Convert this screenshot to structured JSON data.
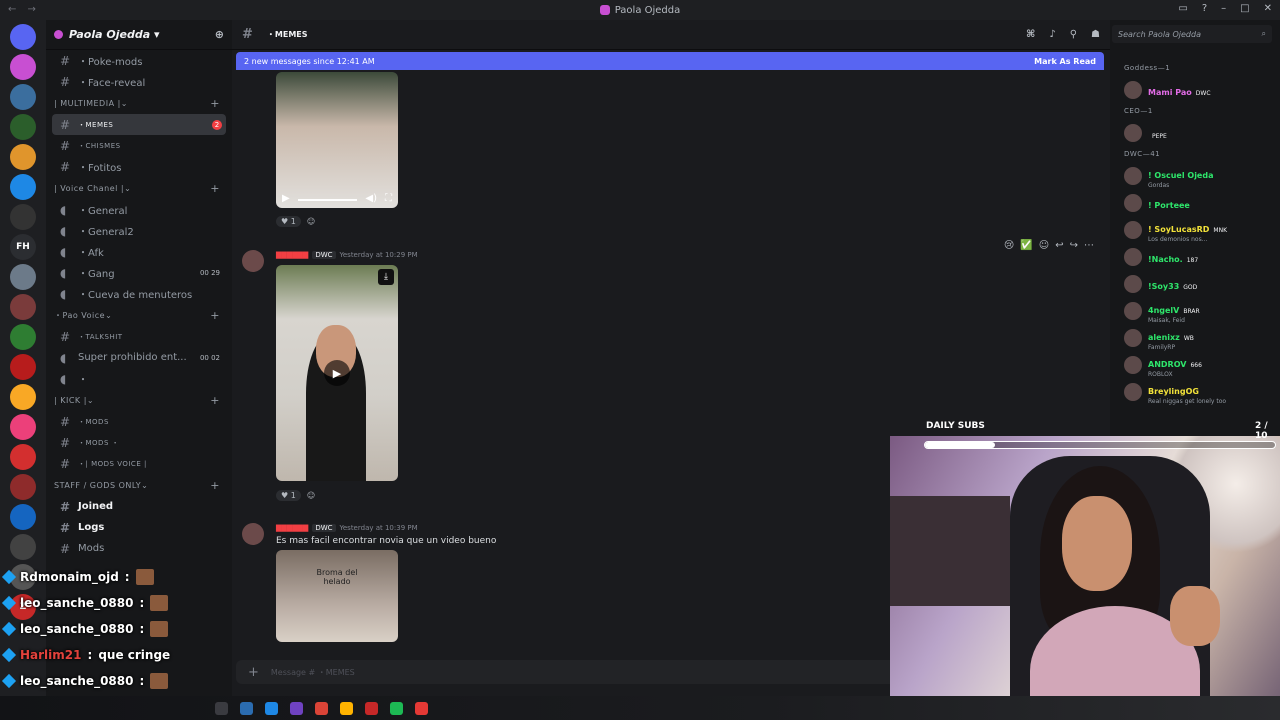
{
  "titlebar": {
    "title": "Paola Ojedda",
    "nav": "← →"
  },
  "servers": [
    {
      "label": "",
      "color": "#5865f2"
    },
    {
      "label": "",
      "color": "#c84fd2"
    },
    {
      "label": "",
      "color": "#3b6e9e"
    },
    {
      "label": "",
      "color": "#2b5e2b"
    },
    {
      "label": "",
      "color": "#e0952c"
    },
    {
      "label": "",
      "color": "#1e88e5"
    },
    {
      "label": "",
      "color": "#333"
    },
    {
      "label": "FH",
      "color": "#2b2d31"
    },
    {
      "label": "",
      "color": "#6c7a89"
    },
    {
      "label": "",
      "color": "#7a3b3b"
    },
    {
      "label": "",
      "color": "#2e7d32"
    },
    {
      "label": "",
      "color": "#b71c1c"
    },
    {
      "label": "",
      "color": "#f9a825"
    },
    {
      "label": "",
      "color": "#ec407a"
    },
    {
      "label": "",
      "color": "#d32f2f"
    },
    {
      "label": "",
      "color": "#8e2b2b"
    },
    {
      "label": "",
      "color": "#1565c0"
    },
    {
      "label": "",
      "color": "#424242"
    },
    {
      "label": "",
      "color": "#555"
    },
    {
      "label": "Z",
      "color": "#c62828"
    }
  ],
  "sidebar": {
    "server_name": "Paola Ojedda",
    "items": [
      {
        "type": "ch",
        "label": "・Poke-mods"
      },
      {
        "type": "ch",
        "label": "・Face-reveal"
      },
      {
        "type": "cat",
        "label": "| MULTIMEDIA |"
      },
      {
        "type": "ch",
        "label": "・MEMES",
        "small": true,
        "active": true,
        "badge": "2"
      },
      {
        "type": "ch",
        "label": "・CHISMES",
        "small": true
      },
      {
        "type": "ch",
        "label": "・Fotitos"
      },
      {
        "type": "cat",
        "label": "| Voice Chanel |"
      },
      {
        "type": "vc",
        "label": "・General"
      },
      {
        "type": "vc",
        "label": "・General2"
      },
      {
        "type": "vc",
        "label": "・Afk"
      },
      {
        "type": "vc",
        "label": "・Gang",
        "count": "00 29"
      },
      {
        "type": "vc",
        "label": "・Cueva de menuteros"
      },
      {
        "type": "cat",
        "label": "・Pao Voice"
      },
      {
        "type": "ch",
        "label": "・TALKSHIT",
        "small": true
      },
      {
        "type": "vc",
        "label": "Super prohibido ent...",
        "count": "00 02"
      },
      {
        "type": "vc",
        "label": "・"
      },
      {
        "type": "cat",
        "label": "| KICK |"
      },
      {
        "type": "ch",
        "label": "・MODS",
        "small": true
      },
      {
        "type": "ch",
        "label": "・MODS ・",
        "small": true
      },
      {
        "type": "ch",
        "label": "・| MODS VOICE |",
        "small": true
      },
      {
        "type": "cat",
        "label": "STAFF / GODS ONLY"
      },
      {
        "type": "ch",
        "label": "Joined",
        "bold": true
      },
      {
        "type": "ch",
        "label": "Logs",
        "bold": true
      },
      {
        "type": "ch",
        "label": "Mods"
      }
    ]
  },
  "chat": {
    "channel": "・MEMES",
    "new_messages": "2 new messages since 12:41 AM",
    "mark_as_read": "Mark As Read",
    "msg1": {
      "react_count": "1"
    },
    "msg2": {
      "tag": "DWC",
      "time": "Yesterday at 10:29 PM",
      "react_count": "1"
    },
    "msg3": {
      "tag": "DWC",
      "time": "Yesterday at 10:39 PM",
      "text": "Es mas facil encontrar novia que un video bueno",
      "video_caption": "Broma del helado"
    },
    "composer_placeholder": "Message # ・MEMES"
  },
  "members": {
    "search_placeholder": "Search Paola Ojedda",
    "groups": [
      {
        "category": "Goddess—1",
        "members": [
          {
            "name": "Mami Pao",
            "color": "#e26ce6",
            "tag": "DWC",
            "sub": ""
          }
        ]
      },
      {
        "category": "CEO—1",
        "members": [
          {
            "name": "",
            "color": "#2b4ad4",
            "tag": "PEPE",
            "sub": ""
          }
        ]
      },
      {
        "category": "DWC—41",
        "members": [
          {
            "name": "! Oscuel Ojeda",
            "color": "#2ee66b",
            "tag": "",
            "sub": "Gordas"
          },
          {
            "name": "! Porteee",
            "color": "#2ee66b",
            "tag": "",
            "sub": ""
          },
          {
            "name": "! SoyLucasRD",
            "color": "#f2e23a",
            "tag": "MNK",
            "sub": "Los demonios nos..."
          },
          {
            "name": "!Nacho.",
            "color": "#2ee66b",
            "tag": "187",
            "sub": ""
          },
          {
            "name": "!Soy33",
            "color": "#2ee66b",
            "tag": "GOD",
            "sub": ""
          },
          {
            "name": "4ngelV",
            "color": "#2ee66b",
            "tag": "BRAR",
            "sub": "Maisak, Feid"
          },
          {
            "name": "alenixz",
            "color": "#2ee66b",
            "tag": "WB",
            "sub": "FamilyRP"
          },
          {
            "name": "ANDROV",
            "color": "#2ee66b",
            "tag": "666",
            "sub": "ROBLOX"
          },
          {
            "name": "BreylingOG",
            "color": "#f2e23a",
            "tag": "",
            "sub": "Real niggas get lonely too"
          }
        ]
      }
    ]
  },
  "stream": {
    "daily_subs_label": "DAILY SUBS",
    "daily_subs_count": "2 / 10",
    "daily_subs_progress": 0.2
  },
  "overlay_chat": [
    {
      "user": "Rdmonaim_ojd",
      "text": "",
      "red": false
    },
    {
      "user": "leo_sanche_0880",
      "text": "",
      "red": false
    },
    {
      "user": "leo_sanche_0880",
      "text": "",
      "red": false
    },
    {
      "user": "Harlim21",
      "text": "que cringe",
      "red": true
    },
    {
      "user": "leo_sanche_0880",
      "text": "",
      "red": false
    },
    {
      "user": "leo_sanche_0880",
      "text": "",
      "red": false
    }
  ],
  "taskbar": [
    "#3a3b40",
    "#2b6cb0",
    "#1e88e5",
    "#6f42c1",
    "#db4437",
    "#ffb300",
    "#c62828",
    "#1db954",
    "#e53935"
  ]
}
